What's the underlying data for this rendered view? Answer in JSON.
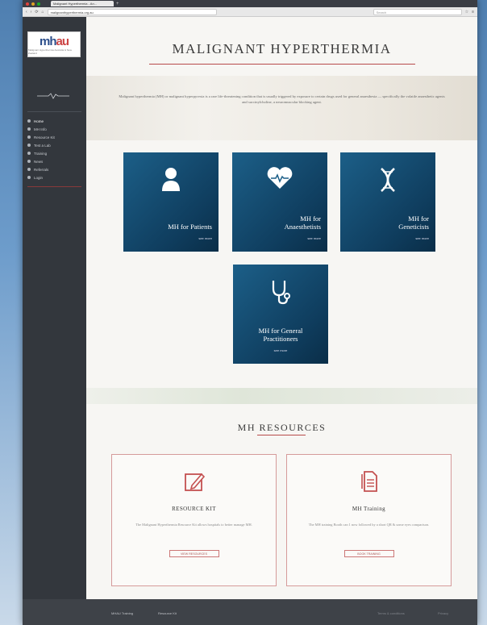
{
  "browser": {
    "tab_title": "Malignant Hyperthermia - An...",
    "url": "malignanthyperthermia.org.au",
    "search_placeholder": "Search",
    "new_tab": "+"
  },
  "sidebar": {
    "logo_text_a": "mh",
    "logo_text_b": "au",
    "logo_tag": "Malignant Hyperthermia Australia & New Zealand",
    "items": [
      {
        "label": "Home"
      },
      {
        "label": "MH Info"
      },
      {
        "label": "Resource Kit"
      },
      {
        "label": "Test a Lab"
      },
      {
        "label": "Training"
      },
      {
        "label": "News"
      },
      {
        "label": "Referrals"
      },
      {
        "label": "Login"
      }
    ]
  },
  "main": {
    "title": "MALIGNANT HYPERTHERMIA",
    "intro": "Malignant hyperthermia (MH) or malignant hyperpyrexia is a rare life-threatening condition that is usually triggered by exposure to certain drugs used for general anaesthesia — specifically the volatile anaesthetic agents and succinylcholine, a neuromuscular blocking agent.",
    "cards": [
      {
        "label_1": "MH for Patients",
        "label_2": "",
        "more": "see more"
      },
      {
        "label_1": "MH for",
        "label_2": "Anaesthetists",
        "more": "see more"
      },
      {
        "label_1": "MH for",
        "label_2": "Geneticists",
        "more": "see more"
      },
      {
        "label_1": "MH for General",
        "label_2": "Practitioners",
        "more": "see more"
      }
    ],
    "resources_title": "MH RESOURCES",
    "resources": [
      {
        "title": "RESOURCE KIT",
        "text": "The Malignant Hyperthermia Resource Kit allows hospitals to better manage MH.",
        "button": "VIEW RESOURCES"
      },
      {
        "title": "MH Training",
        "text": "The MH training Booth can 1 now followed by a short QR & some eyes comparison.",
        "button": "BOOK TRAINING"
      }
    ]
  },
  "footer": {
    "link_1": "MHAU Training",
    "link_2": "Resource Kit",
    "right_1": "Terms & conditions",
    "right_2": "Privacy"
  },
  "colors": {
    "accent": "#b84a4a",
    "card": "#1c5f88",
    "sidebar": "#33373d"
  }
}
